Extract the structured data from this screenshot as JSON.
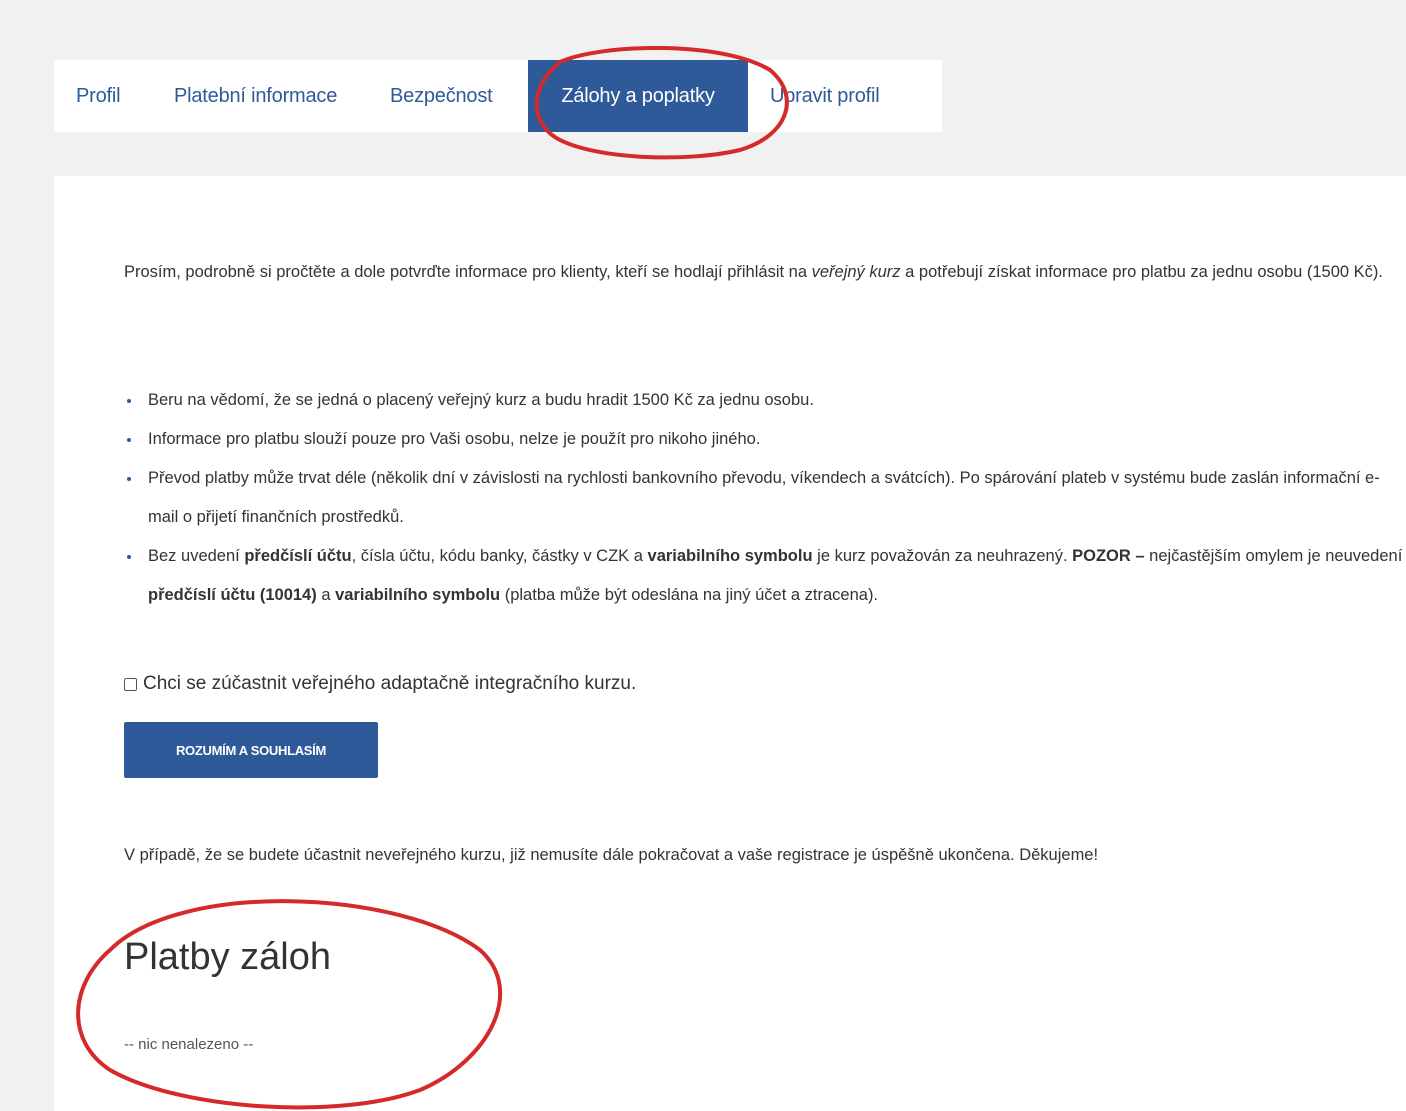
{
  "tabs": [
    {
      "label": "Profil"
    },
    {
      "label": "Platební informace"
    },
    {
      "label": "Bezpečnost"
    },
    {
      "label": "Zálohy a poplatky",
      "active": true
    },
    {
      "label": "Upravit profil"
    }
  ],
  "intro": {
    "part1": "Prosím, podrobně si pročtěte a dole potvrďte informace pro klienty, kteří se hodlají přihlásit na ",
    "emph": "veřejný kurz",
    "part2": " a potřebují získat informace pro platbu za jednu osobu (1500 Kč)."
  },
  "rules": {
    "r1": "Beru na vědomí, že se jedná o placený veřejný kurz a budu hradit 1500 Kč za jednu osobu.",
    "r2": "Informace pro platbu slouží pouze pro Vaši osobu, nelze je použít pro nikoho jiného.",
    "r3": "Převod platby může trvat déle (několik dní v závislosti na rychlosti bankovního převodu, víkendech a svátcích). Po spárování plateb v systému bude zaslán informační e-mail o přijetí finančních prostředků.",
    "r4": {
      "a": "Bez uvedení ",
      "b": "předčíslí účtu",
      "c": ", čísla účtu, kódu banky, částky v CZK a ",
      "d": "variabilního symbolu",
      "e": " je kurz považován za neuhrazený. ",
      "f": "POZOR –",
      "g": " nejčastějším omylem je neuvedení ",
      "h": "předčíslí účtu (10014)",
      "i": " a ",
      "j": "variabilního symbolu",
      "k": " (platba může být odeslána na jiný účet a ztracena)."
    }
  },
  "checkbox": {
    "label": "Chci se zúčastnit veřejného adaptačně integračního kurzu.",
    "checked": false
  },
  "agree_button": "ROZUMÍM A SOUHLASÍM",
  "closing": "V případě, že se budete účastnit neveřejného kurzu, již nemusíte dále pokračovat a vaše registrace je úspěšně ukončena. Děkujeme!",
  "section": {
    "title": "Platby záloh",
    "empty": "-- nic nenalezeno --"
  },
  "colors": {
    "accent": "#2f5a9a",
    "annotation": "#d42a2a"
  }
}
